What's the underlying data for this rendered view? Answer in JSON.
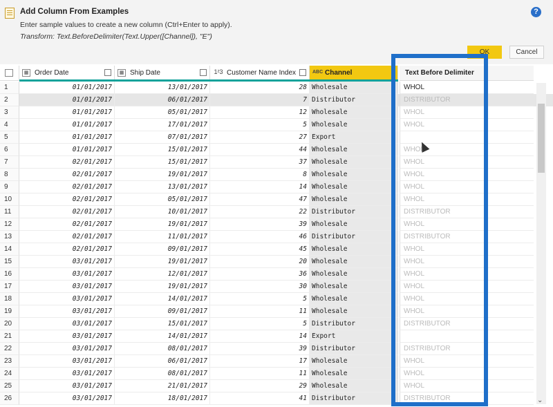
{
  "dialog": {
    "title": "Add Column From Examples",
    "instructions": "Enter sample values to create a new column (Ctrl+Enter to apply).",
    "transform": "Transform: Text.BeforeDelimiter(Text.Upper([Channel]), \"E\")",
    "help": "?",
    "ok_label": "OK",
    "cancel_label": "Cancel"
  },
  "columns": {
    "order_date": "Order Date",
    "ship_date": "Ship Date",
    "customer_index": "Customer Name Index",
    "channel": "Channel",
    "text_before": "Text Before Delimiter",
    "type_date": "▦",
    "type_num": "1²3",
    "type_text": "ABC"
  },
  "rows": [
    {
      "i": "1",
      "od": "01/01/2017",
      "sd": "13/01/2017",
      "ci": "28",
      "ch": "Wholesale",
      "tb": "WHOL"
    },
    {
      "i": "2",
      "od": "01/01/2017",
      "sd": "06/01/2017",
      "ci": "7",
      "ch": "Distributor",
      "tb": "DISTRIBUTOR"
    },
    {
      "i": "3",
      "od": "01/01/2017",
      "sd": "05/01/2017",
      "ci": "12",
      "ch": "Wholesale",
      "tb": "WHOL"
    },
    {
      "i": "4",
      "od": "01/01/2017",
      "sd": "17/01/2017",
      "ci": "5",
      "ch": "Wholesale",
      "tb": "WHOL"
    },
    {
      "i": "5",
      "od": "01/01/2017",
      "sd": "07/01/2017",
      "ci": "27",
      "ch": "Export",
      "tb": ""
    },
    {
      "i": "6",
      "od": "01/01/2017",
      "sd": "15/01/2017",
      "ci": "44",
      "ch": "Wholesale",
      "tb": "WHOL"
    },
    {
      "i": "7",
      "od": "02/01/2017",
      "sd": "15/01/2017",
      "ci": "37",
      "ch": "Wholesale",
      "tb": "WHOL"
    },
    {
      "i": "8",
      "od": "02/01/2017",
      "sd": "19/01/2017",
      "ci": "8",
      "ch": "Wholesale",
      "tb": "WHOL"
    },
    {
      "i": "9",
      "od": "02/01/2017",
      "sd": "13/01/2017",
      "ci": "14",
      "ch": "Wholesale",
      "tb": "WHOL"
    },
    {
      "i": "10",
      "od": "02/01/2017",
      "sd": "05/01/2017",
      "ci": "47",
      "ch": "Wholesale",
      "tb": "WHOL"
    },
    {
      "i": "11",
      "od": "02/01/2017",
      "sd": "10/01/2017",
      "ci": "22",
      "ch": "Distributor",
      "tb": "DISTRIBUTOR"
    },
    {
      "i": "12",
      "od": "02/01/2017",
      "sd": "19/01/2017",
      "ci": "39",
      "ch": "Wholesale",
      "tb": "WHOL"
    },
    {
      "i": "13",
      "od": "02/01/2017",
      "sd": "11/01/2017",
      "ci": "46",
      "ch": "Distributor",
      "tb": "DISTRIBUTOR"
    },
    {
      "i": "14",
      "od": "02/01/2017",
      "sd": "09/01/2017",
      "ci": "45",
      "ch": "Wholesale",
      "tb": "WHOL"
    },
    {
      "i": "15",
      "od": "03/01/2017",
      "sd": "19/01/2017",
      "ci": "20",
      "ch": "Wholesale",
      "tb": "WHOL"
    },
    {
      "i": "16",
      "od": "03/01/2017",
      "sd": "12/01/2017",
      "ci": "36",
      "ch": "Wholesale",
      "tb": "WHOL"
    },
    {
      "i": "17",
      "od": "03/01/2017",
      "sd": "19/01/2017",
      "ci": "30",
      "ch": "Wholesale",
      "tb": "WHOL"
    },
    {
      "i": "18",
      "od": "03/01/2017",
      "sd": "14/01/2017",
      "ci": "5",
      "ch": "Wholesale",
      "tb": "WHOL"
    },
    {
      "i": "19",
      "od": "03/01/2017",
      "sd": "09/01/2017",
      "ci": "11",
      "ch": "Wholesale",
      "tb": "WHOL"
    },
    {
      "i": "20",
      "od": "03/01/2017",
      "sd": "15/01/2017",
      "ci": "5",
      "ch": "Distributor",
      "tb": "DISTRIBUTOR"
    },
    {
      "i": "21",
      "od": "03/01/2017",
      "sd": "14/01/2017",
      "ci": "14",
      "ch": "Export",
      "tb": ""
    },
    {
      "i": "22",
      "od": "03/01/2017",
      "sd": "08/01/2017",
      "ci": "39",
      "ch": "Distributor",
      "tb": "DISTRIBUTOR"
    },
    {
      "i": "23",
      "od": "03/01/2017",
      "sd": "06/01/2017",
      "ci": "17",
      "ch": "Wholesale",
      "tb": "WHOL"
    },
    {
      "i": "24",
      "od": "03/01/2017",
      "sd": "08/01/2017",
      "ci": "11",
      "ch": "Wholesale",
      "tb": "WHOL"
    },
    {
      "i": "25",
      "od": "03/01/2017",
      "sd": "21/01/2017",
      "ci": "29",
      "ch": "Wholesale",
      "tb": "WHOL"
    },
    {
      "i": "26",
      "od": "03/01/2017",
      "sd": "18/01/2017",
      "ci": "41",
      "ch": "Distributor",
      "tb": "DISTRIBUTOR"
    }
  ],
  "colors": {
    "accent_yellow": "#f2c811",
    "highlight_blue": "#1f6fc9",
    "quality_teal": "#10a29a"
  }
}
